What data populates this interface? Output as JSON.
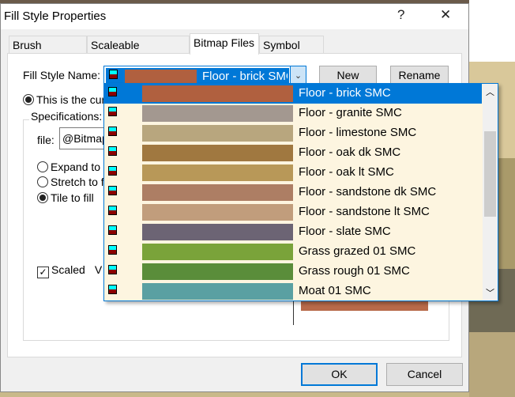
{
  "window": {
    "title": "Fill Style Properties",
    "help_label": "?",
    "close_label": "✕"
  },
  "tabs": [
    {
      "label": "Brush Patterns"
    },
    {
      "label": "Scaleable Hatching"
    },
    {
      "label": "Bitmap Files",
      "active": true
    },
    {
      "label": "Symbol Fills"
    }
  ],
  "fill_style": {
    "label": "Fill Style Name:",
    "selected": "Floor - brick SMC",
    "selected_color": "#b0603f",
    "new_label": "New",
    "rename_label": "Rename"
  },
  "current_radio": {
    "label": "This is the cur",
    "checked": true
  },
  "specifications": {
    "label": "Specifications:",
    "file_label": "file:",
    "file_value": "@Bitmap",
    "options": [
      {
        "label": "Expand to f",
        "checked": false
      },
      {
        "label": "Stretch to fi",
        "checked": false
      },
      {
        "label": "Tile to fill",
        "checked": true
      }
    ],
    "scaled": {
      "label": "Scaled",
      "checked": true
    },
    "trailing_label": "V"
  },
  "dropdown_items": [
    {
      "label": "Floor - brick SMC",
      "color": "#b0603f",
      "selected": true
    },
    {
      "label": "Floor - granite SMC",
      "color": "#a39890"
    },
    {
      "label": "Floor - limestone SMC",
      "color": "#b8a67e"
    },
    {
      "label": "Floor - oak dk SMC",
      "color": "#a07840"
    },
    {
      "label": "Floor - oak lt SMC",
      "color": "#b89858"
    },
    {
      "label": "Floor - sandstone dk SMC",
      "color": "#ad7e64"
    },
    {
      "label": "Floor - sandstone lt SMC",
      "color": "#c19d7c"
    },
    {
      "label": "Floor - slate SMC",
      "color": "#6c6474"
    },
    {
      "label": "Grass grazed 01 SMC",
      "color": "#7aa33a"
    },
    {
      "label": "Grass rough 01 SMC",
      "color": "#5a8d3a"
    },
    {
      "label": "Moat 01 SMC",
      "color": "#5aa0a2"
    }
  ],
  "preview_color": "#b86a4a",
  "footer": {
    "ok_label": "OK",
    "cancel_label": "Cancel"
  }
}
